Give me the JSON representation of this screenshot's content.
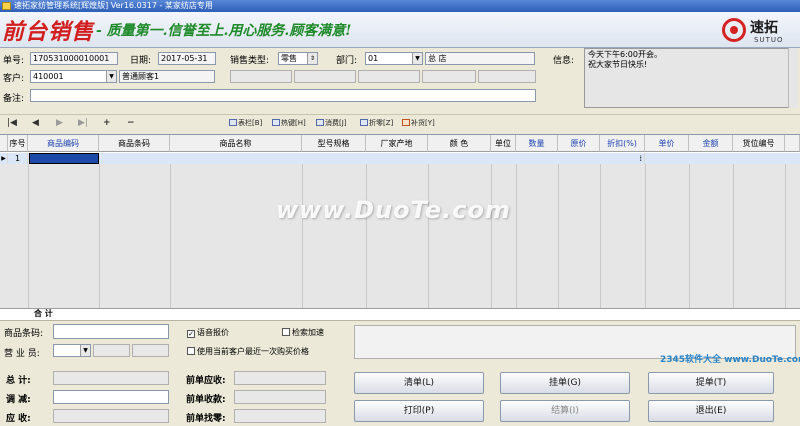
{
  "window": {
    "title": "速拓家纺管理系统[辉煌版] Ver16.0317 - 某家纺店专用"
  },
  "banner": {
    "brand": "前台销售",
    "slogan": "- 质量第一.信誉至上.用心服务.顾客满意!",
    "logo_cn": "速拓",
    "logo_en": "SUTUO"
  },
  "form": {
    "doc_no_label": "单号:",
    "doc_no": "170531000010001",
    "date_label": "日期:",
    "date": "2017-05-31",
    "sale_type_label": "销售类型:",
    "sale_type": "零售",
    "dept_label": "部门:",
    "dept_code": "01",
    "dept_name": "总  店",
    "customer_label": "客户:",
    "customer_code": "410001",
    "customer_name": "普通顾客1",
    "note_label": "备注:",
    "info_label": "信息:",
    "info_text": "今天下午6:00开会。\n祝大家节日快乐!"
  },
  "toolbar": {
    "nav": [
      "|◀",
      "◀",
      "▶",
      "▶|",
      "+",
      "−"
    ],
    "buttons": [
      "表栏[B]",
      "热键[H]",
      "消费[J]",
      "折零[Z]",
      "补货[Y]"
    ]
  },
  "grid": {
    "headers": [
      "序号",
      "商品编码",
      "商品条码",
      "商品名称",
      "型号规格",
      "厂家产地",
      "颜    色",
      "单位",
      "数量",
      "原价",
      "折扣(%)",
      "单价",
      "金额",
      "货位编号"
    ],
    "rows": [
      {
        "seq": "1"
      }
    ],
    "total_label": "合  计"
  },
  "bottom": {
    "barcode_label": "商品条码:",
    "salesman_label": "营 业 员:",
    "voice_label": "语音报价",
    "voice_checked": true,
    "search_accel_label": "检索加速",
    "search_accel_checked": false,
    "last_price_label": "使用当前客户最近一次购买价格",
    "last_price_checked": false,
    "total_label": "总    计:",
    "adjust_label": "调    减:",
    "receivable_label": "应    收:",
    "prev_receivable_label": "前单应收:",
    "prev_received_label": "前单收款:",
    "prev_change_label": "前单找零:",
    "btn_clear": "清单(L)",
    "btn_hold": "挂单(G)",
    "btn_retrieve": "提单(T)",
    "btn_print": "打印(P)",
    "btn_settle": "结算(I)",
    "btn_exit": "退出(E)"
  },
  "watermarks": {
    "center": "www.DuoTe.com",
    "corner": "2345软件大全 www.DuoTe.com"
  },
  "colors": {
    "brand_red": "#d21e1e",
    "slogan_green": "#1f8a2a",
    "header_blue": "#1a3fb0"
  }
}
